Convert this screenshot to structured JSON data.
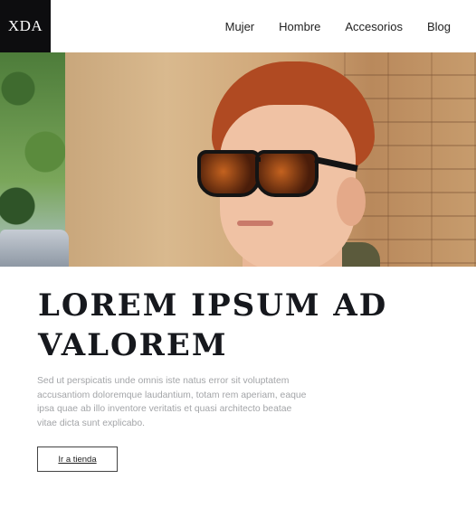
{
  "logo": {
    "text": "XDA"
  },
  "nav": {
    "items": [
      "Mujer",
      "Hombre",
      "Accesorios",
      "Blog"
    ]
  },
  "hero": {
    "title_line1": "LOREM IPSUM AD",
    "title_line2": "VALOREM",
    "description": "Sed ut perspicatis unde omnis iste natus error sit voluptatem accusantiom doloremque laudantium, totam rem aperiam, eaque ipsa quae ab illo inventore veritatis et quasi architecto beatae vitae dicta sunt explicabo.",
    "button_label": "Ir a tienda"
  },
  "colors": {
    "logo_bg": "#0d0d0f",
    "title": "#16181d",
    "body_text": "#a3a5a8"
  }
}
